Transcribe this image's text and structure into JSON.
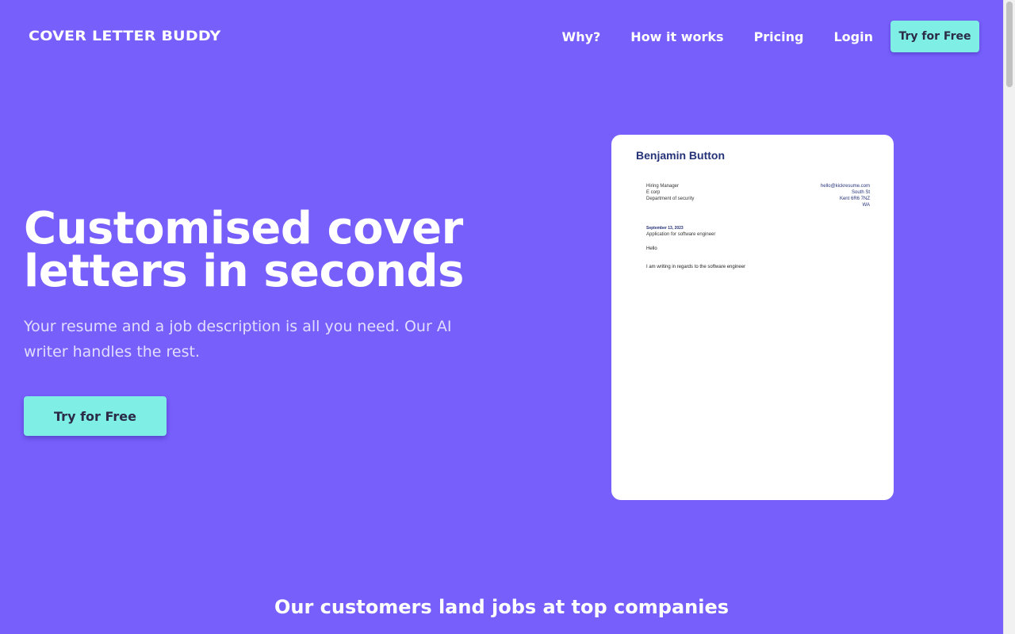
{
  "brand": {
    "logo_text": "COVER LETTER BUDDY"
  },
  "nav": {
    "items": [
      {
        "label": "Why?"
      },
      {
        "label": "How it works"
      },
      {
        "label": "Pricing"
      },
      {
        "label": "Login"
      }
    ],
    "cta_label": "Try for Free"
  },
  "hero": {
    "title_line1": "Customised cover",
    "title_line2": "letters in seconds",
    "subtitle": "Your resume and a job description is all you need. Our AI writer handles the rest.",
    "cta_label": "Try for Free"
  },
  "letter": {
    "name": "Benjamin Button",
    "recipient": [
      "Hiring Manager",
      "E corp",
      "Department of security"
    ],
    "sender": [
      "hello@kickresume.com",
      "South St",
      "Kent 6R6 7NZ",
      "WA"
    ],
    "date": "September 13, 2023",
    "subject": "Application for software engineer",
    "greeting": "Hello",
    "body": "I am writing in regards to the software engineer"
  },
  "customers": {
    "heading": "Our customers land jobs at top companies"
  },
  "colors": {
    "background": "#765ffb",
    "accent": "#7fefe6",
    "accent_text": "#2b2b45",
    "letter_name": "#253278"
  }
}
